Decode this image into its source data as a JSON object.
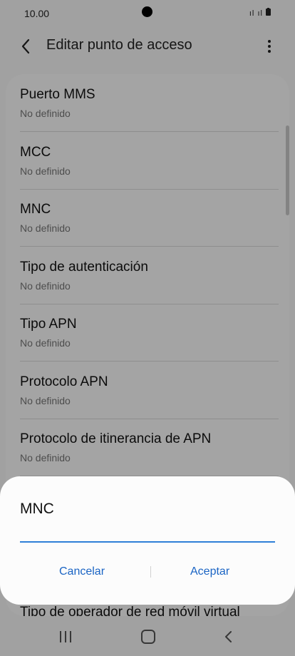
{
  "status_bar": {
    "time": "10.00",
    "signal": "ıl",
    "signal2": "ıl"
  },
  "app_bar": {
    "title": "Editar punto de acceso"
  },
  "settings": [
    {
      "label": "Puerto MMS",
      "value": "No definido"
    },
    {
      "label": "MCC",
      "value": "No definido"
    },
    {
      "label": "MNC",
      "value": "No definido"
    },
    {
      "label": "Tipo de autenticación",
      "value": "No definido"
    },
    {
      "label": "Tipo APN",
      "value": "No definido"
    },
    {
      "label": "Protocolo APN",
      "value": "No definido"
    },
    {
      "label": "Protocolo de itinerancia de APN",
      "value": "No definido"
    },
    {
      "label": "Tipo de operador de red móvil virtual",
      "value": ""
    }
  ],
  "dialog": {
    "title": "MNC",
    "input_value": "",
    "cancel_label": "Cancelar",
    "accept_label": "Aceptar"
  },
  "colors": {
    "accent": "#1a64c4",
    "input_underline": "#2f7fd8"
  }
}
